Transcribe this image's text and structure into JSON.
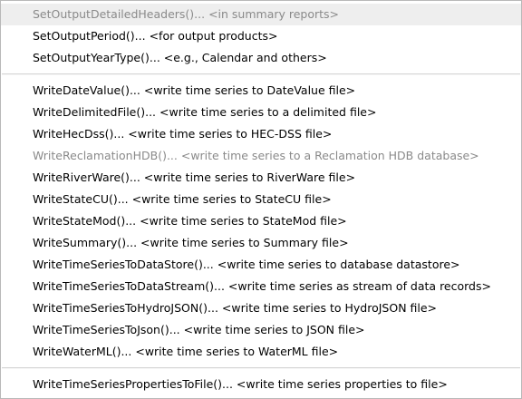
{
  "menu": {
    "groups": [
      {
        "items": [
          {
            "label": "SetOutputDetailedHeaders()... <in summary reports>",
            "enabled": false,
            "highlighted": true
          },
          {
            "label": "SetOutputPeriod()... <for output products>",
            "enabled": true
          },
          {
            "label": "SetOutputYearType()... <e.g., Calendar and others>",
            "enabled": true
          }
        ]
      },
      {
        "items": [
          {
            "label": "WriteDateValue()... <write time series to DateValue file>",
            "enabled": true
          },
          {
            "label": "WriteDelimitedFile()... <write time series to a delimited file>",
            "enabled": true
          },
          {
            "label": "WriteHecDss()... <write time series to HEC-DSS file>",
            "enabled": true
          },
          {
            "label": "WriteReclamationHDB()... <write time series to a Reclamation HDB database>",
            "enabled": false
          },
          {
            "label": "WriteRiverWare()... <write time series to RiverWare file>",
            "enabled": true
          },
          {
            "label": "WriteStateCU()... <write time series to StateCU file>",
            "enabled": true
          },
          {
            "label": "WriteStateMod()... <write time series to StateMod file>",
            "enabled": true
          },
          {
            "label": "WriteSummary()... <write time series to Summary file>",
            "enabled": true
          },
          {
            "label": "WriteTimeSeriesToDataStore()... <write time series to database datastore>",
            "enabled": true
          },
          {
            "label": "WriteTimeSeriesToDataStream()... <write time series as stream of data records>",
            "enabled": true
          },
          {
            "label": "WriteTimeSeriesToHydroJSON()... <write time series to HydroJSON file>",
            "enabled": true
          },
          {
            "label": "WriteTimeSeriesToJson()... <write time series to JSON file>",
            "enabled": true
          },
          {
            "label": "WriteWaterML()... <write time series to WaterML file>",
            "enabled": true
          }
        ]
      },
      {
        "items": [
          {
            "label": "WriteTimeSeriesPropertiesToFile()... <write time series properties to file>",
            "enabled": true
          }
        ]
      }
    ]
  }
}
